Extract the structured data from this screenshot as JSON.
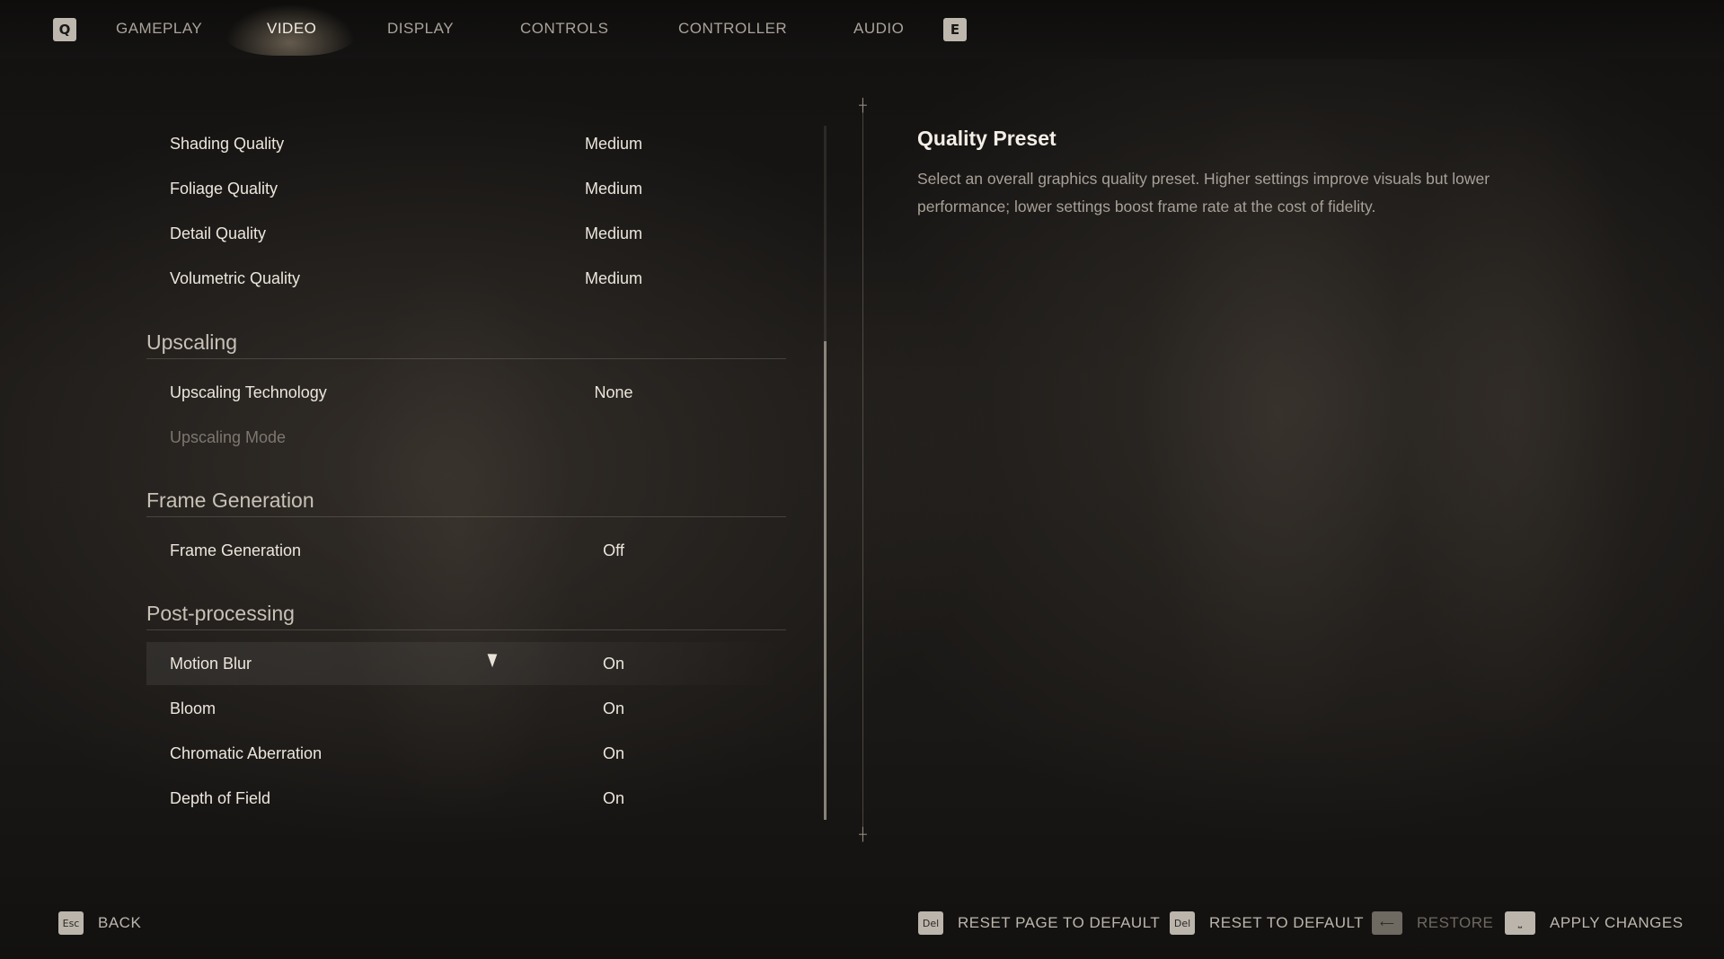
{
  "nav": {
    "prev_key": "Q",
    "next_key": "E",
    "tabs": [
      {
        "label": "GAMEPLAY"
      },
      {
        "label": "VIDEO"
      },
      {
        "label": "DISPLAY"
      },
      {
        "label": "CONTROLS"
      },
      {
        "label": "CONTROLLER"
      },
      {
        "label": "AUDIO"
      }
    ],
    "active_tab": "VIDEO"
  },
  "settings": {
    "quality": [
      {
        "label": "Shading Quality",
        "value": "Medium"
      },
      {
        "label": "Foliage Quality",
        "value": "Medium"
      },
      {
        "label": "Detail Quality",
        "value": "Medium"
      },
      {
        "label": "Volumetric Quality",
        "value": "Medium"
      }
    ],
    "upscaling": {
      "title": "Upscaling",
      "items": [
        {
          "label": "Upscaling Technology",
          "value": "None"
        },
        {
          "label": "Upscaling Mode",
          "value": ""
        }
      ]
    },
    "frame_generation": {
      "title": "Frame Generation",
      "items": [
        {
          "label": "Frame Generation",
          "value": "Off"
        }
      ]
    },
    "post_processing": {
      "title": "Post-processing",
      "items": [
        {
          "label": "Motion Blur",
          "value": "On"
        },
        {
          "label": "Bloom",
          "value": "On"
        },
        {
          "label": "Chromatic Aberration",
          "value": "On"
        },
        {
          "label": "Depth of Field",
          "value": "On"
        }
      ]
    }
  },
  "scrollbar": {
    "thumb_start_fraction": 0.31,
    "thumb_end_fraction": 1.0
  },
  "description": {
    "title": "Quality Preset",
    "body": "Select an overall graphics quality preset. Higher settings improve visuals but lower performance; lower settings boost frame rate at the cost of fidelity."
  },
  "footer": {
    "back": {
      "key": "Esc",
      "label": "BACK"
    },
    "reset_page": {
      "key": "Del",
      "label": "RESET PAGE TO DEFAULT"
    },
    "reset_default": {
      "key": "Del",
      "label": "RESET TO DEFAULT"
    },
    "restore": {
      "key": "⟵",
      "label": "RESTORE"
    },
    "apply": {
      "key": "⎵",
      "label": "APPLY CHANGES"
    }
  }
}
